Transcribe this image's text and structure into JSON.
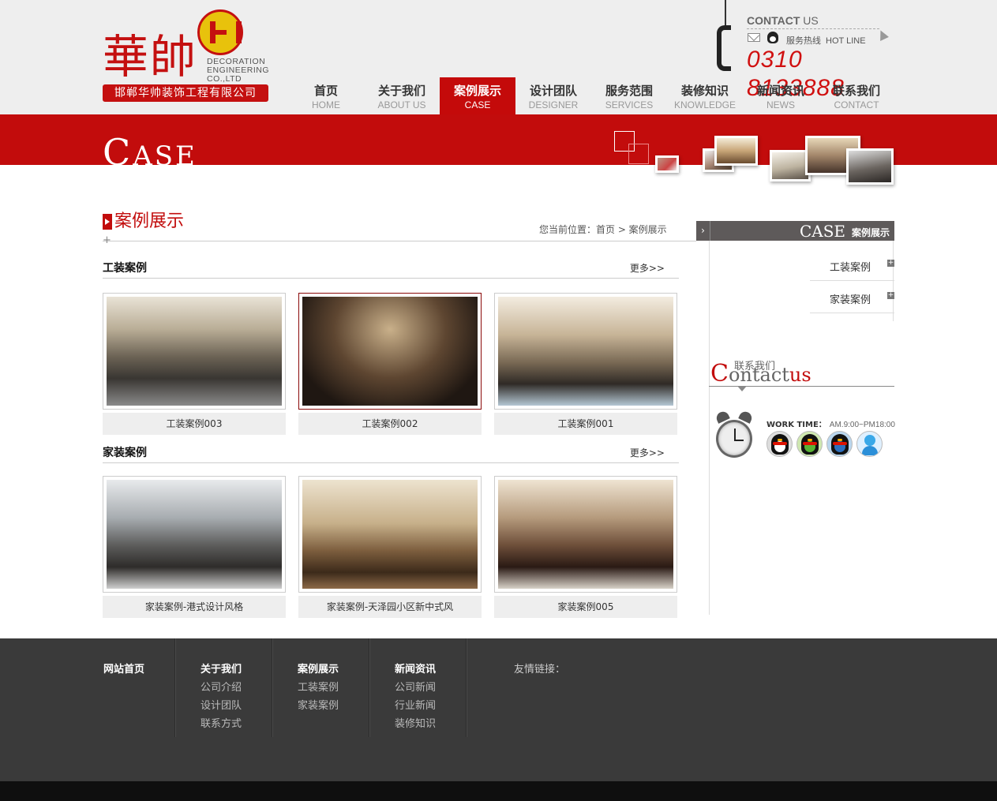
{
  "logo": {
    "cn_big": "華帥",
    "en_line1": "DECORATION",
    "en_line2": "ENGINEERING",
    "en_line3": "CO.,LTD",
    "company": "邯郸华帅装饰工程有限公司"
  },
  "contact": {
    "title_bold": "CONTACT",
    "title_rest": " US",
    "hotline_cn": "服务热线",
    "hotline_en": "HOT LINE",
    "phone": "0310  8133888"
  },
  "nav": [
    {
      "cn": "首页",
      "en": "HOME"
    },
    {
      "cn": "关于我们",
      "en": "ABOUT US"
    },
    {
      "cn": "案例展示",
      "en": "CASE"
    },
    {
      "cn": "设计团队",
      "en": "DESIGNER"
    },
    {
      "cn": "服务范围",
      "en": "SERVICES"
    },
    {
      "cn": "装修知识",
      "en": "KNOWLEDGE"
    },
    {
      "cn": "新闻资讯",
      "en": "NEWS"
    },
    {
      "cn": "联系我们",
      "en": "CONTACT"
    }
  ],
  "banner": {
    "title_big": "C",
    "title_small": "ASE"
  },
  "page": {
    "title": "案例展示",
    "breadcrumb": "您当前位置：首页 > 案例展示",
    "plus": "+"
  },
  "sections": [
    {
      "title": "工装案例",
      "more": "更多>>",
      "items": [
        {
          "caption": "工装案例003"
        },
        {
          "caption": "工装案例002"
        },
        {
          "caption": "工装案例001"
        }
      ]
    },
    {
      "title": "家装案例",
      "more": "更多>>",
      "items": [
        {
          "caption": "家装案例-港式设计风格"
        },
        {
          "caption": "家装案例-天泽园小区新中式风"
        },
        {
          "caption": "家装案例005"
        }
      ]
    }
  ],
  "sidebar": {
    "head_en": "CASE",
    "head_cn": "案例展示",
    "items": [
      {
        "label": "工装案例"
      },
      {
        "label": "家装案例"
      }
    ],
    "contact_cn": "联系我们",
    "contact_en_first": "C",
    "contact_en_mid": "ontact",
    "contact_en_end": "us",
    "work_label": "WORK TIME：",
    "work_value": "AM.9:00~PM18:00"
  },
  "footer": {
    "home": "网站首页",
    "about": {
      "head": "关于我们",
      "links": [
        "公司介绍",
        "设计团队",
        "联系方式"
      ]
    },
    "case": {
      "head": "案例展示",
      "links": [
        "工装案例",
        "家装案例"
      ]
    },
    "news": {
      "head": "新闻资讯",
      "links": [
        "公司新闻",
        "行业新闻",
        "装修知识"
      ]
    },
    "friend_links": "友情链接："
  },
  "colors": {
    "brand_red": "#c20c0c",
    "footer_bg": "#3a3a3a",
    "header_bg": "#eeeeee"
  }
}
